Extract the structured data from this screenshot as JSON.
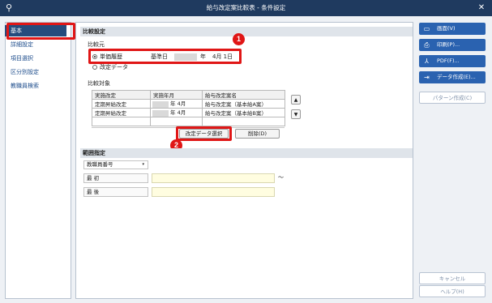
{
  "window": {
    "title": "給与改定案比較表 - 条件設定",
    "close_glyph": "✕",
    "app_icon_glyph": "⚲"
  },
  "nav": {
    "items": [
      {
        "label": "基本",
        "active": true
      },
      {
        "label": "詳細設定"
      },
      {
        "label": "項目選択"
      },
      {
        "label": "区分別設定"
      },
      {
        "label": "教職員検索"
      }
    ]
  },
  "compare": {
    "section_title": "比較設定",
    "source_label": "比較元",
    "radio_history": "単価履歴",
    "base_date_label": "基準日",
    "base_date_year_suffix": "年",
    "base_date_md": "4月 1日",
    "radio_revision": "改定データ",
    "target_label": "比較対象",
    "table": {
      "headers": [
        "実施改定",
        "実施年月",
        "給与改定案名"
      ],
      "rows": [
        {
          "revision": "定期昇給改定",
          "ym": "年 4月",
          "name": "給与改定案（基本給A案）"
        },
        {
          "revision": "定期昇給改定",
          "ym": "年 4月",
          "name": "給与改定案（基本給B案）"
        },
        {
          "revision": "",
          "ym": "",
          "name": ""
        }
      ]
    },
    "select_button": "改定データ選択",
    "delete_button": "削除(D)",
    "up_glyph": "▲",
    "down_glyph": "▼"
  },
  "range": {
    "section_title": "範囲指定",
    "field_select": "教職員番号",
    "first_label": "最 初",
    "last_label": "最 後",
    "tilde": "～"
  },
  "badges": [
    "1",
    "2"
  ],
  "actions": {
    "screen": "画面(V)",
    "print": "印刷(P)...",
    "pdf": "PDF(F)...",
    "data": "データ作成(E)...",
    "pattern": "パターン作成(C)",
    "cancel": "キャンセル",
    "help": "ヘルプ(H)"
  },
  "colors": {
    "titlebar": "#1f3a5f",
    "accent": "#2a62b0",
    "highlight": "#e01616",
    "input_highlight": "#fffde0"
  }
}
